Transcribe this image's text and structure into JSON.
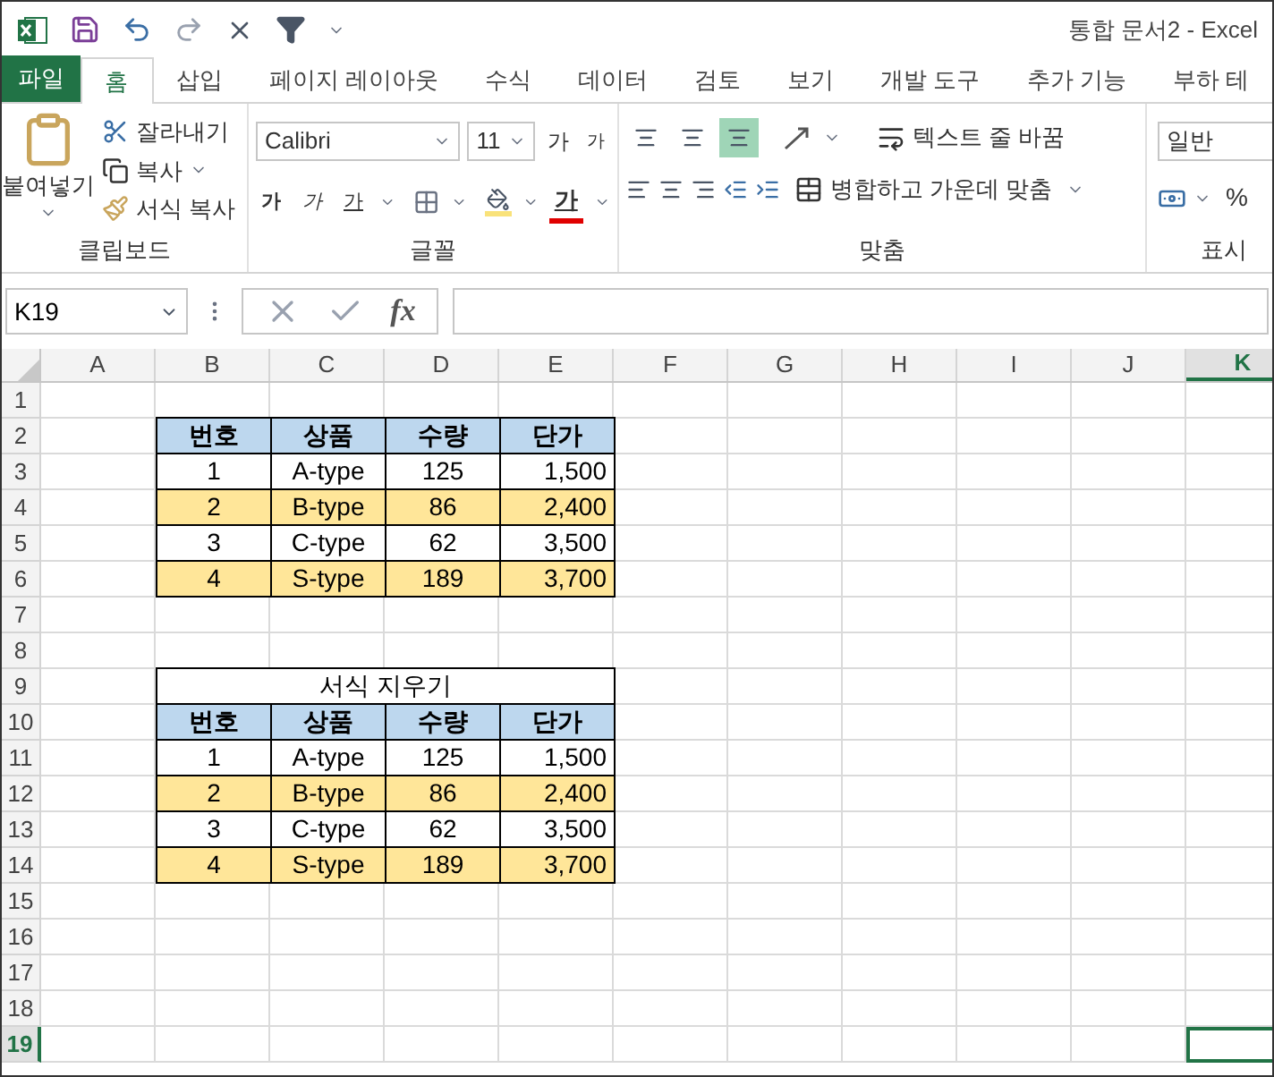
{
  "title_bar": {
    "title": "통합 문서2 - Excel"
  },
  "tabs": [
    {
      "label": "파일",
      "kind": "file",
      "selected": false
    },
    {
      "label": "홈",
      "kind": "tab",
      "selected": true
    },
    {
      "label": "삽입",
      "kind": "tab",
      "selected": false
    },
    {
      "label": "페이지 레이아웃",
      "kind": "tab",
      "selected": false
    },
    {
      "label": "수식",
      "kind": "tab",
      "selected": false
    },
    {
      "label": "데이터",
      "kind": "tab",
      "selected": false
    },
    {
      "label": "검토",
      "kind": "tab",
      "selected": false
    },
    {
      "label": "보기",
      "kind": "tab",
      "selected": false
    },
    {
      "label": "개발 도구",
      "kind": "tab",
      "selected": false
    },
    {
      "label": "추가 기능",
      "kind": "tab",
      "selected": false
    },
    {
      "label": "부하 테",
      "kind": "tab",
      "selected": false
    }
  ],
  "ribbon": {
    "clipboard": {
      "label": "클립보드",
      "paste": "붙여넣기",
      "cut": "잘라내기",
      "copy": "복사",
      "format_painter": "서식 복사"
    },
    "font": {
      "label": "글꼴",
      "font_name": "Calibri",
      "font_size": "11",
      "grow": "가",
      "shrink": "가",
      "bold": "가",
      "italic": "가",
      "underline": "가",
      "font_color": "가"
    },
    "alignment": {
      "label": "맞춤",
      "vertical": [
        {
          "selected": false
        },
        {
          "selected": false
        },
        {
          "selected": true
        }
      ],
      "wrap_text": "텍스트 줄 바꿈",
      "merge_center": "병합하고 가운데 맞춤"
    },
    "number": {
      "label": "표시",
      "format": "일반",
      "percent": "%"
    }
  },
  "formula_bar": {
    "name_box": "K19",
    "fx": "fx"
  },
  "sheet": {
    "columns": [
      {
        "label": "A",
        "selected": false
      },
      {
        "label": "B",
        "selected": false
      },
      {
        "label": "C",
        "selected": false
      },
      {
        "label": "D",
        "selected": false
      },
      {
        "label": "E",
        "selected": false
      },
      {
        "label": "F",
        "selected": false
      },
      {
        "label": "G",
        "selected": false
      },
      {
        "label": "H",
        "selected": false
      },
      {
        "label": "I",
        "selected": false
      },
      {
        "label": "J",
        "selected": false
      },
      {
        "label": "K",
        "selected": true
      }
    ],
    "rows": [
      {
        "number": "1",
        "selected": false
      },
      {
        "number": "2",
        "selected": false
      },
      {
        "number": "3",
        "selected": false
      },
      {
        "number": "4",
        "selected": false
      },
      {
        "number": "5",
        "selected": false
      },
      {
        "number": "6",
        "selected": false
      },
      {
        "number": "7",
        "selected": false
      },
      {
        "number": "8",
        "selected": false
      },
      {
        "number": "9",
        "selected": false
      },
      {
        "number": "10",
        "selected": false
      },
      {
        "number": "11",
        "selected": false
      },
      {
        "number": "12",
        "selected": false
      },
      {
        "number": "13",
        "selected": false
      },
      {
        "number": "14",
        "selected": false
      },
      {
        "number": "15",
        "selected": false
      },
      {
        "number": "16",
        "selected": false
      },
      {
        "number": "17",
        "selected": false
      },
      {
        "number": "18",
        "selected": false
      },
      {
        "number": "19",
        "selected": true
      }
    ],
    "tables": [
      {
        "header": [
          "번호",
          "상품",
          "수량",
          "단가"
        ],
        "rows": [
          {
            "highlighted": false,
            "cells": [
              "1",
              "A-type",
              "125",
              "1,500"
            ]
          },
          {
            "highlighted": true,
            "cells": [
              "2",
              "B-type",
              "86",
              "2,400"
            ]
          },
          {
            "highlighted": false,
            "cells": [
              "3",
              "C-type",
              "62",
              "3,500"
            ]
          },
          {
            "highlighted": true,
            "cells": [
              "4",
              "S-type",
              "189",
              "3,700"
            ]
          }
        ]
      },
      {
        "title": "서식 지우기",
        "header": [
          "번호",
          "상품",
          "수량",
          "단가"
        ],
        "rows": [
          {
            "highlighted": false,
            "cells": [
              "1",
              "A-type",
              "125",
              "1,500"
            ]
          },
          {
            "highlighted": true,
            "cells": [
              "2",
              "B-type",
              "86",
              "2,400"
            ]
          },
          {
            "highlighted": false,
            "cells": [
              "3",
              "C-type",
              "62",
              "3,500"
            ]
          },
          {
            "highlighted": true,
            "cells": [
              "4",
              "S-type",
              "189",
              "3,700"
            ]
          }
        ]
      }
    ]
  }
}
